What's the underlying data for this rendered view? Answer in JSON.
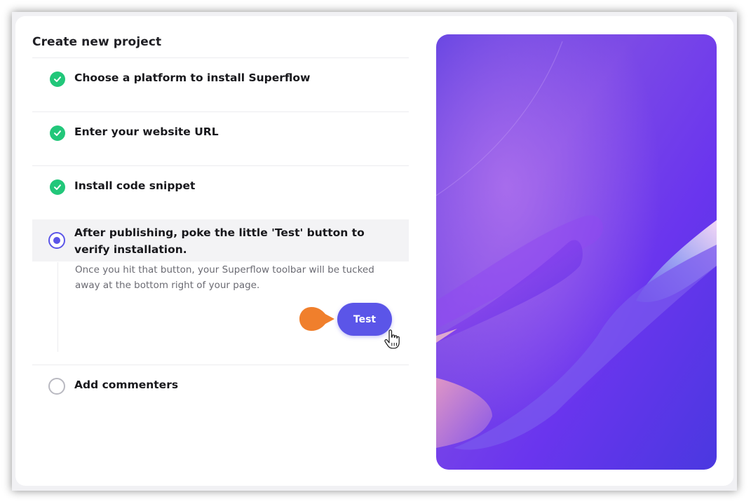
{
  "dialog": {
    "title": "Create new project"
  },
  "steps": [
    {
      "label": "Choose a platform to install Superflow",
      "status": "completed"
    },
    {
      "label": "Enter your website URL",
      "status": "completed"
    },
    {
      "label": "Install code snippet",
      "status": "completed"
    },
    {
      "label": "After publishing, poke the little 'Test' button to verify installation.",
      "status": "active",
      "description": "Once you hit that button, your Superflow toolbar will be tucked away at the bottom right of your page.",
      "button_label": "Test"
    },
    {
      "label": "Add commenters",
      "status": "pending"
    }
  ],
  "colors": {
    "accent": "#5b55e8",
    "success": "#22c77a",
    "pointer": "#f07f2c"
  },
  "icons": {
    "completed": "check-circle-icon",
    "active": "radio-selected-icon",
    "pending": "radio-empty-icon",
    "cursor": "hand-pointer-icon"
  }
}
